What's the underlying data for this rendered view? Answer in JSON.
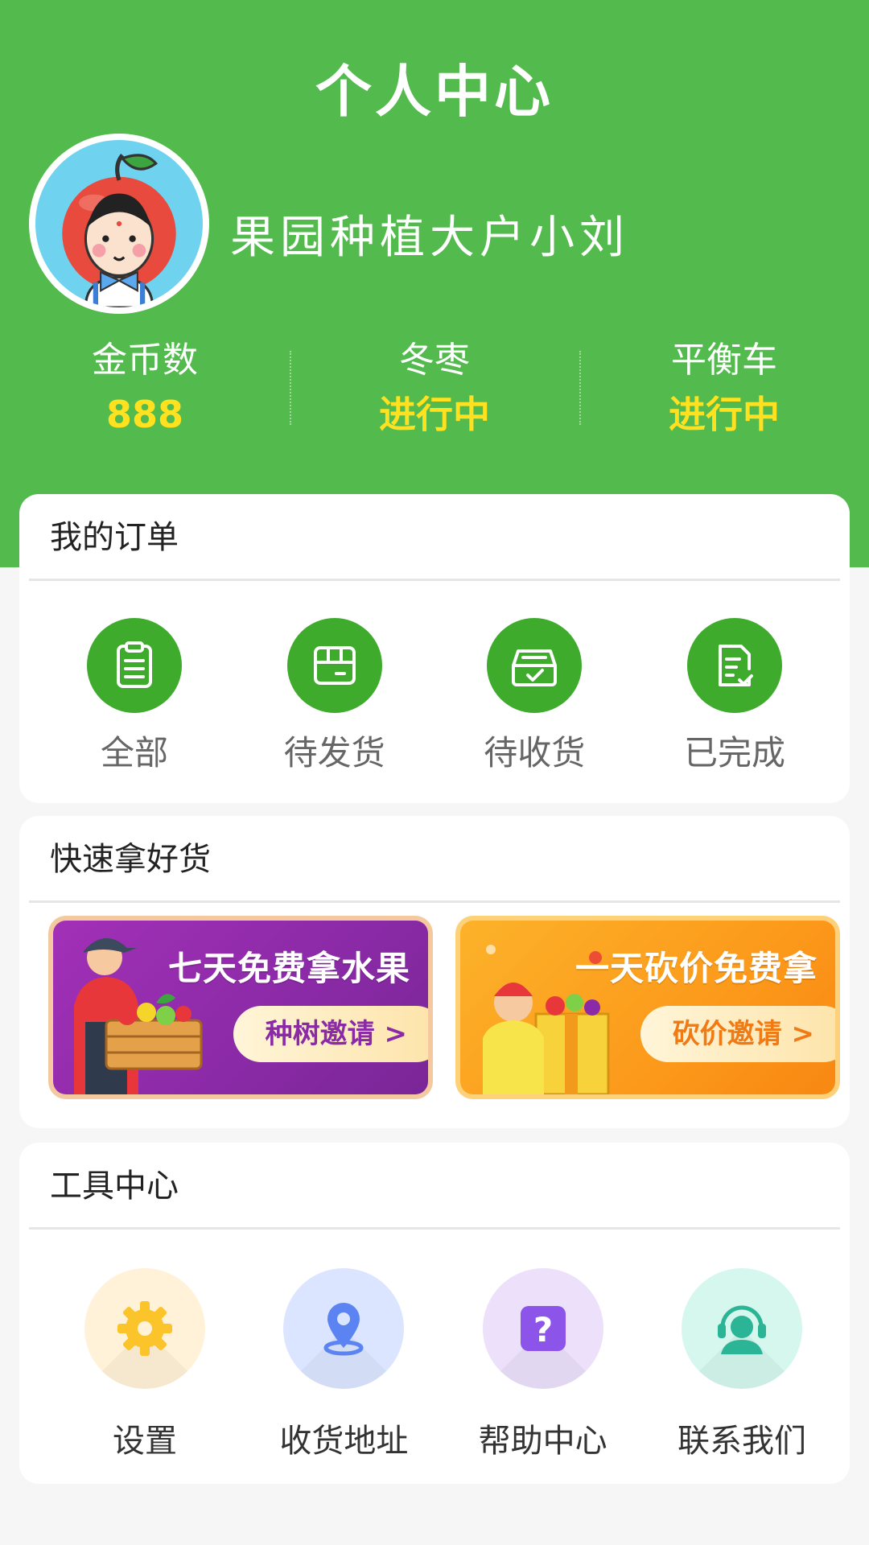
{
  "header": {
    "title": "个人中心",
    "username": "果园种植大户小刘"
  },
  "stats": [
    {
      "label": "金币数",
      "value": "888"
    },
    {
      "label": "冬枣",
      "value": "进行中"
    },
    {
      "label": "平衡车",
      "value": "进行中"
    }
  ],
  "orders": {
    "title": "我的订单",
    "items": [
      {
        "label": "全部",
        "icon": "clipboard-icon"
      },
      {
        "label": "待发货",
        "icon": "box-icon"
      },
      {
        "label": "待收货",
        "icon": "inbox-check-icon"
      },
      {
        "label": "已完成",
        "icon": "document-check-icon"
      }
    ]
  },
  "goods": {
    "title": "快速拿好货",
    "banners": [
      {
        "title": "七天免费拿水果",
        "button": "种树邀请 >"
      },
      {
        "title": "一天砍价免费拿",
        "button": "砍价邀请 >"
      }
    ]
  },
  "tools": {
    "title": "工具中心",
    "items": [
      {
        "label": "设置",
        "icon": "gear-icon"
      },
      {
        "label": "收货地址",
        "icon": "location-pin-icon"
      },
      {
        "label": "帮助中心",
        "icon": "question-icon"
      },
      {
        "label": "联系我们",
        "icon": "customer-service-icon"
      }
    ]
  },
  "colors": {
    "header_green": "#53ba4d",
    "stat_yellow": "#ffe11f",
    "order_icon_green": "#3eab2d"
  }
}
